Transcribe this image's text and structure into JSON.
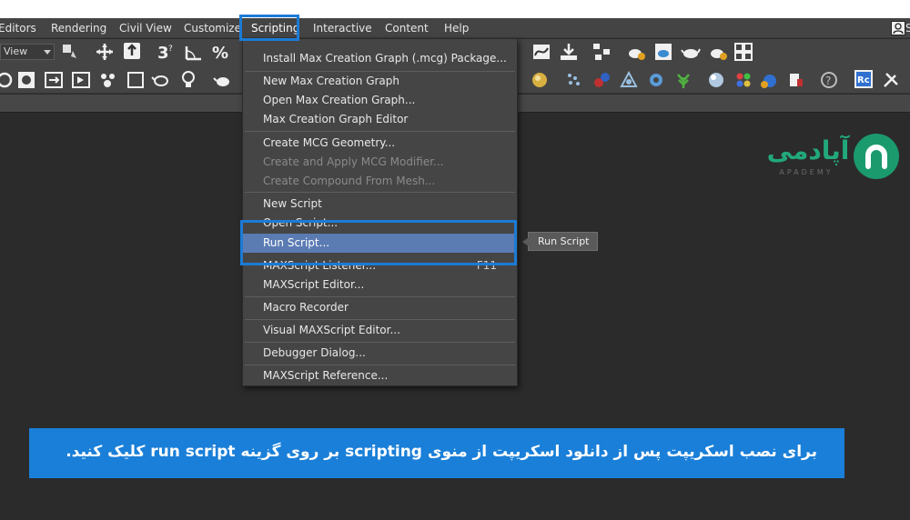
{
  "menubar": {
    "items": [
      "Editors",
      "Rendering",
      "Civil View",
      "Customize",
      "Scripting",
      "Interactive",
      "Content",
      "Help"
    ],
    "active": "Scripting",
    "user_label": "S"
  },
  "toolbar": {
    "view_select": "View",
    "icons_row1": [
      "select-link-icon",
      "move-icon",
      "place-icon",
      "snap-3d-icon",
      "angle-snap-icon",
      "percent-snap-icon",
      "curve-editor-icon",
      "render-setup-icon",
      "schematic-icon",
      "teapot-render-icon",
      "render-frame-icon",
      "render-icon",
      "render-iterative-icon",
      "grid-icon"
    ],
    "icons_row2": [
      "rotate-icon",
      "clone-icon",
      "align-icon",
      "mirror-icon",
      "track-icon",
      "frame-icon",
      "teapot-icon",
      "light-bulb-icon",
      "teapot-small-icon",
      "sphere-icon",
      "particle-icon",
      "shatter-icon",
      "gear-icon",
      "plant-icon",
      "sphere-gloss-icon",
      "color-dots-icon",
      "spheres-icon",
      "box-dashed-icon",
      "stack-icon",
      "help-icon",
      "rc-button-icon",
      "tools-icon"
    ]
  },
  "scripting_menu": {
    "items": [
      {
        "label": "Install Max Creation Graph (.mcg) Package...",
        "enabled": true
      },
      {
        "label": "New Max Creation Graph",
        "enabled": true
      },
      {
        "label": "Open Max Creation Graph...",
        "enabled": true
      },
      {
        "label": "Max Creation Graph Editor",
        "enabled": true
      },
      {
        "label": "Create MCG Geometry...",
        "enabled": true
      },
      {
        "label": "Create and Apply MCG Modifier...",
        "enabled": false
      },
      {
        "label": "Create Compound From Mesh...",
        "enabled": false
      },
      {
        "label": "New Script",
        "enabled": true
      },
      {
        "label": "Open Script...",
        "enabled": true
      },
      {
        "label": "Run Script...",
        "enabled": true,
        "highlighted": true
      },
      {
        "label": "MAXScript Listener...",
        "shortcut": "F11",
        "enabled": true
      },
      {
        "label": "MAXScript Editor...",
        "enabled": true
      },
      {
        "label": "Macro Recorder",
        "enabled": true
      },
      {
        "label": "Visual MAXScript Editor...",
        "enabled": true
      },
      {
        "label": "Debugger Dialog...",
        "enabled": true
      },
      {
        "label": "MAXScript Reference...",
        "enabled": true
      }
    ]
  },
  "tooltip": "Run Script",
  "logo": {
    "text": "آپادمی",
    "sub": "APADEMY"
  },
  "banner": {
    "text": "برای نصب  اسکریپت پس از دانلود اسکریپت از منوی scripting بر روی گزینه run script کلیک کنید."
  },
  "colors": {
    "highlight_border": "#1c7bd6",
    "menu_selection": "#5b7bb3",
    "banner": "#1a7fd8",
    "logo_green": "#1b9a6d"
  }
}
